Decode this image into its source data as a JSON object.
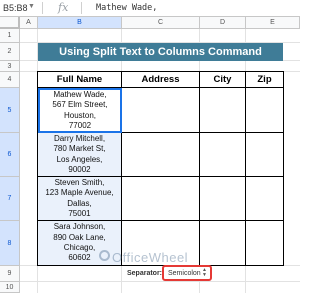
{
  "formula_bar": {
    "name_box": "B5:B8",
    "fx": "fx",
    "content": "Mathew Wade,"
  },
  "columns": [
    "A",
    "B",
    "C",
    "D",
    "E"
  ],
  "rows": [
    "1",
    "2",
    "3",
    "4",
    "5",
    "6",
    "7",
    "8",
    "9",
    "10"
  ],
  "title": "Using Split Text to Columns Command",
  "headers": [
    "Full Name",
    "Address",
    "City",
    "Zip"
  ],
  "names": [
    "Mathew Wade,\n567 Elm Street,\nHouston,\n77002",
    "Darry Mitchell,\n780 Market St,\nLos Angeles,\n90002",
    "Steven Smith,\n123 Maple Avenue,\nDallas,\n75001",
    "Sara Johnson,\n890 Oak Lane,\nChicago,\n60602"
  ],
  "separator": {
    "label": "Separator:",
    "value": "Semicolon"
  },
  "watermark": "OfficeWheel",
  "colors": {
    "title_bg": "#3f7c97",
    "selection": "#1a73e8",
    "highlight": "#e53935"
  }
}
